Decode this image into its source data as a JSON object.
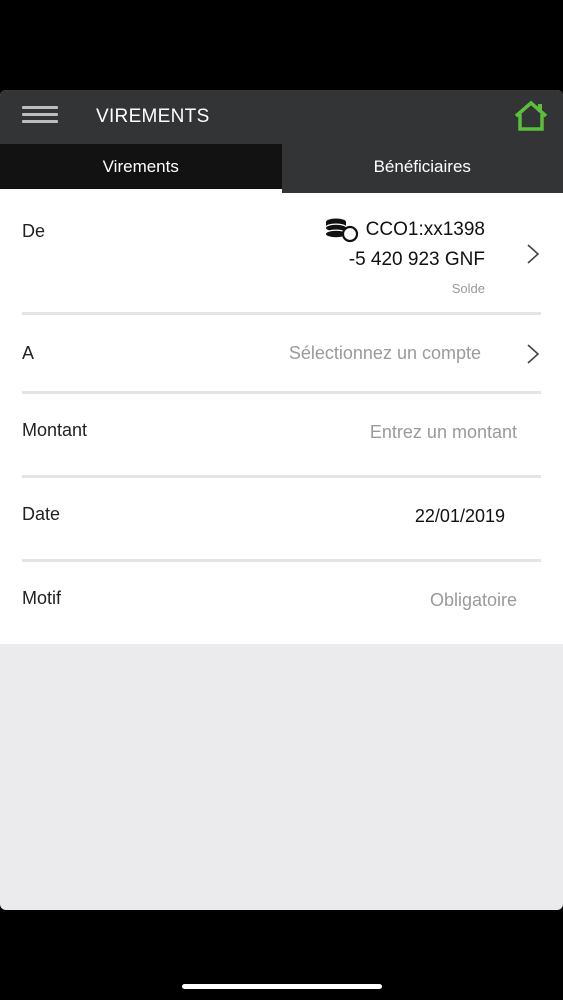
{
  "header": {
    "title": "VIREMENTS",
    "menu_icon": "hamburger-menu-icon",
    "home_icon": "home-icon",
    "home_color": "#5bbf3a"
  },
  "tabs": [
    {
      "label": "Virements",
      "active": true
    },
    {
      "label": "Bénéficiaires",
      "active": false
    }
  ],
  "form": {
    "from": {
      "label": "De",
      "account": "CCO1:xx1398",
      "balance": "-5 420 923 GNF",
      "balance_caption": "Solde",
      "icon": "coins-icon"
    },
    "to": {
      "label": "A",
      "placeholder": "Sélectionnez un compte"
    },
    "amount": {
      "label": "Montant",
      "placeholder": "Entrez un montant"
    },
    "date": {
      "label": "Date",
      "value": "22/01/2019"
    },
    "reason": {
      "label": "Motif",
      "placeholder": "Obligatoire"
    }
  }
}
